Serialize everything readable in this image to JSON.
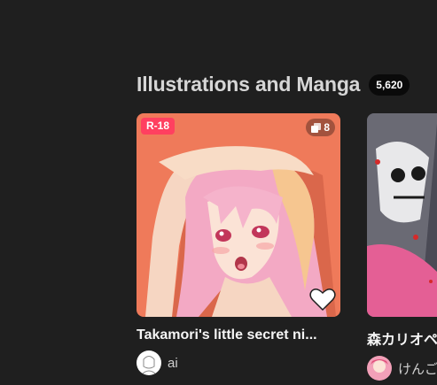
{
  "section": {
    "title": "Illustrations and Manga",
    "count": "5,620"
  },
  "cards": [
    {
      "rating_badge": "R-18",
      "page_count": "8",
      "title": "Takamori's little secret ni...",
      "author": "ai",
      "bg_color": "#ef7a5a"
    },
    {
      "title": "森カリオペ",
      "author": "けんご",
      "bg_color": "#4a4a55"
    }
  ],
  "icons": {
    "pages": "pages-icon",
    "like": "heart-icon"
  },
  "colors": {
    "background": "#1f1f1f",
    "r18_badge": "#ff4060",
    "title_text": "#f5f5f5"
  }
}
